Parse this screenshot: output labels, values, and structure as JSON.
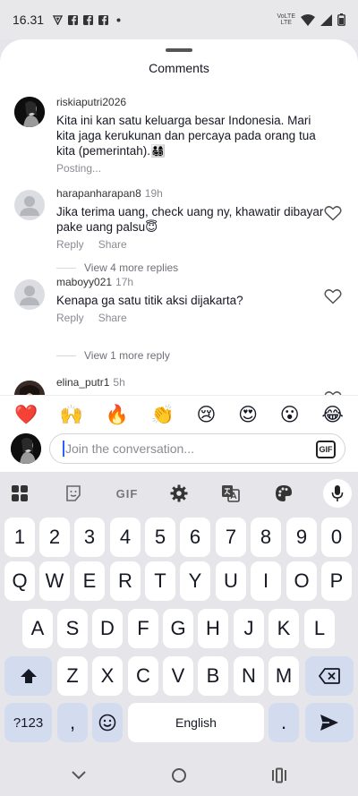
{
  "status_bar": {
    "time": "16.31",
    "network_label_top": "VoLTE",
    "network_label_bottom": "LTE"
  },
  "sheet": {
    "title": "Comments"
  },
  "comments": [
    {
      "username": "riskiaputri2026",
      "time": "",
      "text": "Kita ini kan satu keluarga besar Indonesia. Mari kita jaga kerukunan dan percaya pada orang tua kita (pemerintah).👨‍👩‍👧‍👦",
      "status": "Posting..."
    },
    {
      "username": "harapanharapan8",
      "time": "19h",
      "text": "Jika terima uang, check uang ny, khawatir dibayar pake uang palsu😇",
      "reply_label": "Reply",
      "share_label": "Share",
      "view_replies": "View 4 more replies"
    },
    {
      "username": "maboyy021",
      "time": "17h",
      "text": "Kenapa ga satu titik aksi dijakarta?",
      "reply_label": "Reply",
      "share_label": "Share",
      "view_replies": "View 1 more reply"
    },
    {
      "username": "elina_putr1",
      "time": "5h"
    }
  ],
  "emoji_bar": [
    "❤️",
    "🙌",
    "🔥",
    "👏",
    "😢",
    "😍",
    "😮",
    "😂"
  ],
  "input": {
    "placeholder": "Join the conversation...",
    "gif_label": "GIF"
  },
  "keyboard": {
    "toolbar_gif": "GIF",
    "row_numbers": [
      "1",
      "2",
      "3",
      "4",
      "5",
      "6",
      "7",
      "8",
      "9",
      "0"
    ],
    "row1": [
      "Q",
      "W",
      "E",
      "R",
      "T",
      "Y",
      "U",
      "I",
      "O",
      "P"
    ],
    "row2": [
      "A",
      "S",
      "D",
      "F",
      "G",
      "H",
      "J",
      "K",
      "L"
    ],
    "row3": [
      "Z",
      "X",
      "C",
      "V",
      "B",
      "N",
      "M"
    ],
    "symbols_label": "?123",
    "comma": ",",
    "space_label": "English",
    "period": "."
  }
}
